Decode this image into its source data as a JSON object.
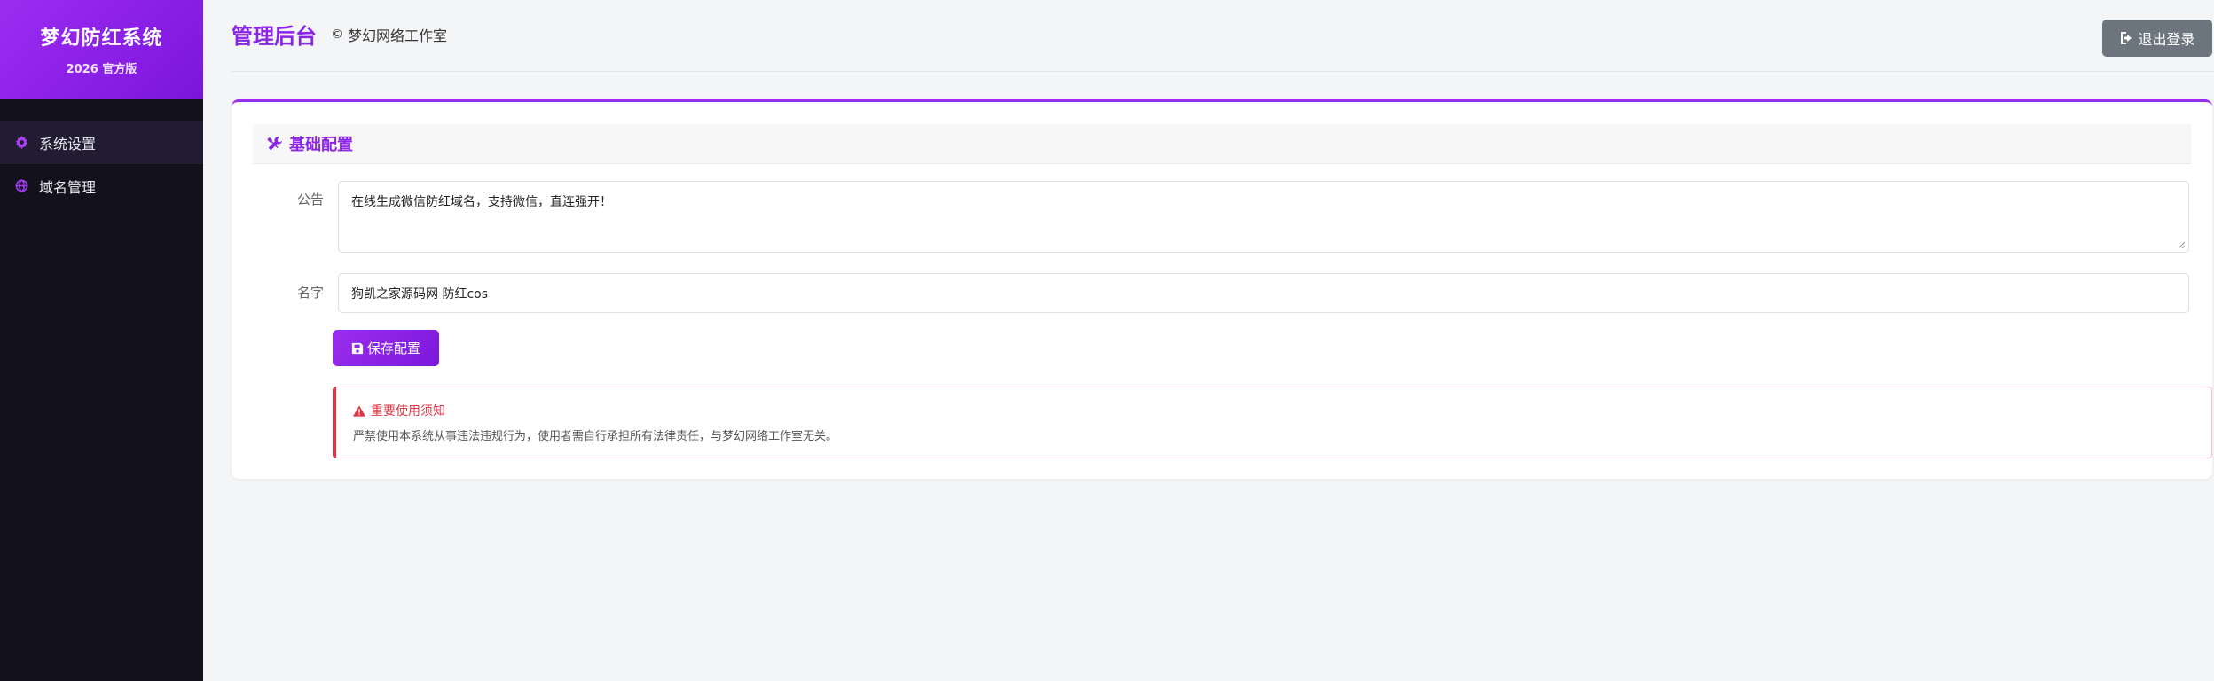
{
  "sidebar": {
    "brand_title": "梦幻防红系统",
    "brand_subtitle": "2026 官方版",
    "items": [
      {
        "label": "系统设置",
        "icon": "gear-icon",
        "active": true
      },
      {
        "label": "域名管理",
        "icon": "globe-icon",
        "active": false
      }
    ]
  },
  "header": {
    "title": "管理后台",
    "copyright_symbol": "©",
    "studio": "梦幻网络工作室",
    "logout_label": "退出登录"
  },
  "card": {
    "title": "基础配置",
    "fields": {
      "notice_label": "公告",
      "notice_value": "在线生成微信防红域名，支持微信，直连强开！",
      "name_label": "名字",
      "name_value": "狗凯之家源码网 防红cos"
    },
    "save_label": "保存配置",
    "alert": {
      "title": "重要使用须知",
      "body": "严禁使用本系统从事违法违规行为，使用者需自行承担所有法律责任，与梦幻网络工作室无关。"
    }
  },
  "colors": {
    "accent": "#8c24e6",
    "sidebar_bg": "#13121c",
    "danger": "#dc3545",
    "logout_bg": "#6c757d"
  }
}
